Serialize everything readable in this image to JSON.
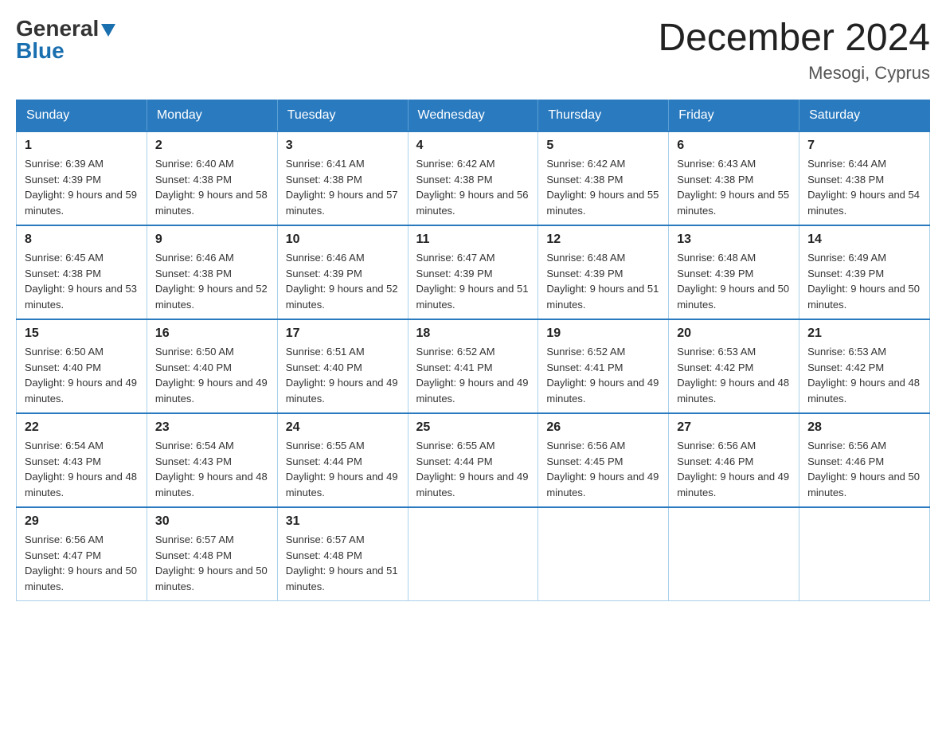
{
  "logo": {
    "line1": "General",
    "line2": "Blue"
  },
  "title": "December 2024",
  "subtitle": "Mesogi, Cyprus",
  "days_of_week": [
    "Sunday",
    "Monday",
    "Tuesday",
    "Wednesday",
    "Thursday",
    "Friday",
    "Saturday"
  ],
  "weeks": [
    [
      {
        "day": "1",
        "sunrise": "6:39 AM",
        "sunset": "4:39 PM",
        "daylight": "9 hours and 59 minutes."
      },
      {
        "day": "2",
        "sunrise": "6:40 AM",
        "sunset": "4:38 PM",
        "daylight": "9 hours and 58 minutes."
      },
      {
        "day": "3",
        "sunrise": "6:41 AM",
        "sunset": "4:38 PM",
        "daylight": "9 hours and 57 minutes."
      },
      {
        "day": "4",
        "sunrise": "6:42 AM",
        "sunset": "4:38 PM",
        "daylight": "9 hours and 56 minutes."
      },
      {
        "day": "5",
        "sunrise": "6:42 AM",
        "sunset": "4:38 PM",
        "daylight": "9 hours and 55 minutes."
      },
      {
        "day": "6",
        "sunrise": "6:43 AM",
        "sunset": "4:38 PM",
        "daylight": "9 hours and 55 minutes."
      },
      {
        "day": "7",
        "sunrise": "6:44 AM",
        "sunset": "4:38 PM",
        "daylight": "9 hours and 54 minutes."
      }
    ],
    [
      {
        "day": "8",
        "sunrise": "6:45 AM",
        "sunset": "4:38 PM",
        "daylight": "9 hours and 53 minutes."
      },
      {
        "day": "9",
        "sunrise": "6:46 AM",
        "sunset": "4:38 PM",
        "daylight": "9 hours and 52 minutes."
      },
      {
        "day": "10",
        "sunrise": "6:46 AM",
        "sunset": "4:39 PM",
        "daylight": "9 hours and 52 minutes."
      },
      {
        "day": "11",
        "sunrise": "6:47 AM",
        "sunset": "4:39 PM",
        "daylight": "9 hours and 51 minutes."
      },
      {
        "day": "12",
        "sunrise": "6:48 AM",
        "sunset": "4:39 PM",
        "daylight": "9 hours and 51 minutes."
      },
      {
        "day": "13",
        "sunrise": "6:48 AM",
        "sunset": "4:39 PM",
        "daylight": "9 hours and 50 minutes."
      },
      {
        "day": "14",
        "sunrise": "6:49 AM",
        "sunset": "4:39 PM",
        "daylight": "9 hours and 50 minutes."
      }
    ],
    [
      {
        "day": "15",
        "sunrise": "6:50 AM",
        "sunset": "4:40 PM",
        "daylight": "9 hours and 49 minutes."
      },
      {
        "day": "16",
        "sunrise": "6:50 AM",
        "sunset": "4:40 PM",
        "daylight": "9 hours and 49 minutes."
      },
      {
        "day": "17",
        "sunrise": "6:51 AM",
        "sunset": "4:40 PM",
        "daylight": "9 hours and 49 minutes."
      },
      {
        "day": "18",
        "sunrise": "6:52 AM",
        "sunset": "4:41 PM",
        "daylight": "9 hours and 49 minutes."
      },
      {
        "day": "19",
        "sunrise": "6:52 AM",
        "sunset": "4:41 PM",
        "daylight": "9 hours and 49 minutes."
      },
      {
        "day": "20",
        "sunrise": "6:53 AM",
        "sunset": "4:42 PM",
        "daylight": "9 hours and 48 minutes."
      },
      {
        "day": "21",
        "sunrise": "6:53 AM",
        "sunset": "4:42 PM",
        "daylight": "9 hours and 48 minutes."
      }
    ],
    [
      {
        "day": "22",
        "sunrise": "6:54 AM",
        "sunset": "4:43 PM",
        "daylight": "9 hours and 48 minutes."
      },
      {
        "day": "23",
        "sunrise": "6:54 AM",
        "sunset": "4:43 PM",
        "daylight": "9 hours and 48 minutes."
      },
      {
        "day": "24",
        "sunrise": "6:55 AM",
        "sunset": "4:44 PM",
        "daylight": "9 hours and 49 minutes."
      },
      {
        "day": "25",
        "sunrise": "6:55 AM",
        "sunset": "4:44 PM",
        "daylight": "9 hours and 49 minutes."
      },
      {
        "day": "26",
        "sunrise": "6:56 AM",
        "sunset": "4:45 PM",
        "daylight": "9 hours and 49 minutes."
      },
      {
        "day": "27",
        "sunrise": "6:56 AM",
        "sunset": "4:46 PM",
        "daylight": "9 hours and 49 minutes."
      },
      {
        "day": "28",
        "sunrise": "6:56 AM",
        "sunset": "4:46 PM",
        "daylight": "9 hours and 50 minutes."
      }
    ],
    [
      {
        "day": "29",
        "sunrise": "6:56 AM",
        "sunset": "4:47 PM",
        "daylight": "9 hours and 50 minutes."
      },
      {
        "day": "30",
        "sunrise": "6:57 AM",
        "sunset": "4:48 PM",
        "daylight": "9 hours and 50 minutes."
      },
      {
        "day": "31",
        "sunrise": "6:57 AM",
        "sunset": "4:48 PM",
        "daylight": "9 hours and 51 minutes."
      },
      null,
      null,
      null,
      null
    ]
  ]
}
